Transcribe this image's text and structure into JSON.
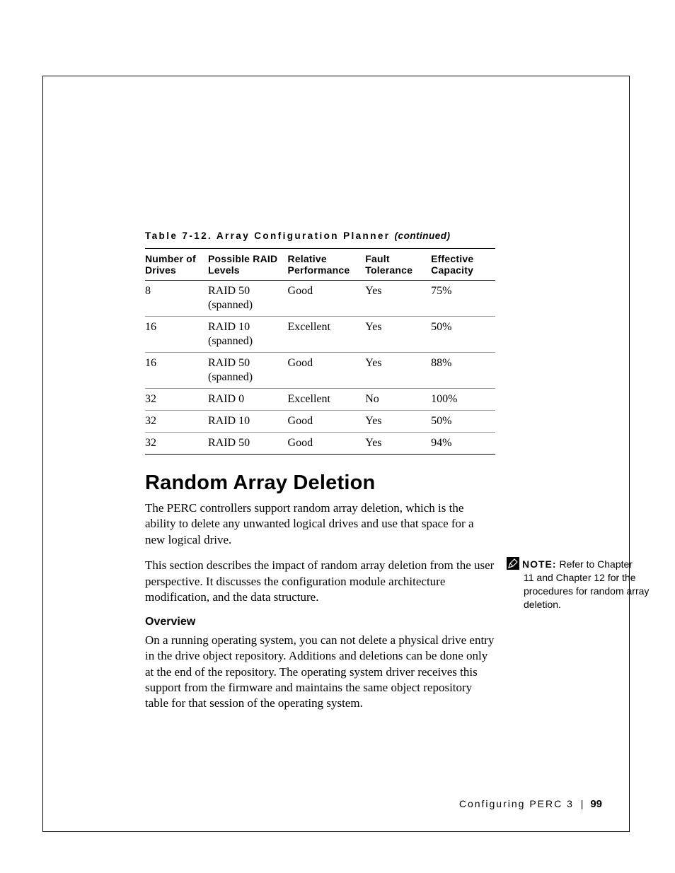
{
  "table": {
    "caption_prefix": "Table 7-12. Array Configuration Planner ",
    "caption_suffix": "(continued)",
    "headers": {
      "drives": "Number of Drives",
      "levels": "Possible RAID Levels",
      "perf": "Relative Performance",
      "fault": "Fault Tolerance",
      "cap": "Effective Capacity"
    },
    "rows": [
      {
        "drives": "8",
        "levels": "RAID 50 (spanned)",
        "perf": "Good",
        "fault": "Yes",
        "cap": "75%"
      },
      {
        "drives": "16",
        "levels": "RAID 10 (spanned)",
        "perf": "Excellent",
        "fault": "Yes",
        "cap": "50%"
      },
      {
        "drives": "16",
        "levels": "RAID 50 (spanned)",
        "perf": "Good",
        "fault": "Yes",
        "cap": "88%"
      },
      {
        "drives": "32",
        "levels": "RAID 0",
        "perf": "Excellent",
        "fault": "No",
        "cap": "100%"
      },
      {
        "drives": "32",
        "levels": "RAID 10",
        "perf": "Good",
        "fault": "Yes",
        "cap": "50%"
      },
      {
        "drives": "32",
        "levels": "RAID 50",
        "perf": "Good",
        "fault": "Yes",
        "cap": "94%"
      }
    ]
  },
  "section": {
    "heading": "Random Array Deletion",
    "para1": "The PERC controllers support random array deletion, which is the ability to delete any unwanted logical drives and use that space for a new logical drive.",
    "para2": "This section describes the impact of random array deletion from the user perspective. It discusses the configuration module architecture modification, and the data structure.",
    "subheading": "Overview",
    "para3": "On a running operating system, you can not delete a physical drive entry in the drive object repository. Additions and deletions can be done only at the end of the repository. The operating system driver receives this support from the firmware and maintains the same object repository table for that session of the operating system."
  },
  "note": {
    "label": "NOTE:",
    "text_first": " Refer to Chapter",
    "text_rest": "11 and Chapter 12 for the procedures for random array deletion."
  },
  "footer": {
    "section": "Configuring PERC 3",
    "page": "99"
  }
}
